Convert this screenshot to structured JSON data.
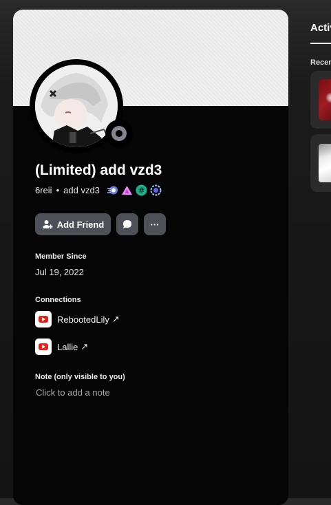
{
  "profile": {
    "display_name": "(Limited) add vzd3",
    "username": "6reii",
    "pronoun_tag": "add vzd3",
    "separator": "•",
    "status": "offline",
    "badges": [
      "nitro-orb-icon",
      "hypesquad-icon",
      "hash-icon",
      "quest-icon"
    ]
  },
  "actions": {
    "add_friend_label": "Add Friend",
    "message_icon": "chat-bubble-icon",
    "more_label": "···"
  },
  "member_since": {
    "label": "Member Since",
    "date": "Jul 19, 2022"
  },
  "connections": {
    "label": "Connections",
    "items": [
      {
        "service": "youtube-icon",
        "name": "RebootedLily",
        "arrow": "↗"
      },
      {
        "service": "youtube-icon",
        "name": "Lallie",
        "arrow": "↗"
      }
    ]
  },
  "note": {
    "label": "Note (only visible to you)",
    "placeholder": "Click to add a note"
  },
  "side_panel": {
    "title": "Activ",
    "recent_label": "Recen"
  },
  "colors": {
    "card_bg": "#050505",
    "button_bg": "#4e5058",
    "status_offline": "#82858f",
    "youtube_red": "#e62117"
  }
}
